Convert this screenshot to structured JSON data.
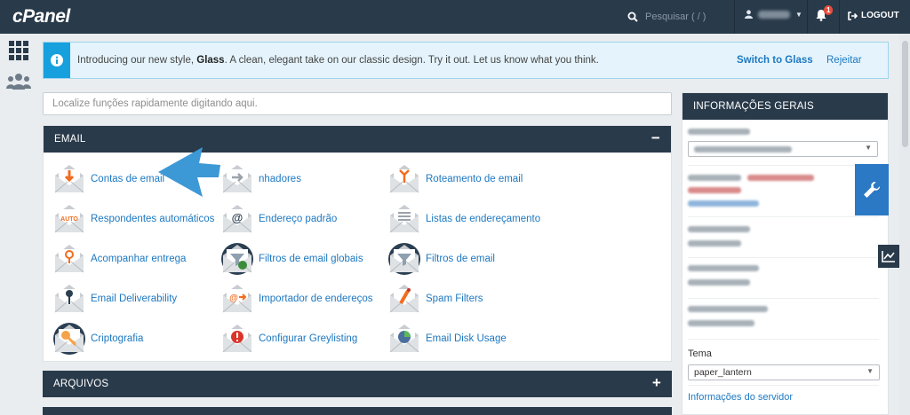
{
  "topbar": {
    "logo": "cPanel",
    "search_placeholder": "Pesquisar ( / )",
    "notification_count": "1",
    "logout_label": "LOGOUT"
  },
  "notice": {
    "text_before": "Introducing our new style, ",
    "text_bold": "Glass",
    "text_after": ". A clean, elegant take on our classic design. Try it out. Let us know what you think.",
    "switch_label": "Switch to Glass",
    "reject_label": "Rejeitar"
  },
  "quickfind": {
    "placeholder": "Localize funções rapidamente digitando aqui."
  },
  "email_section": {
    "title": "EMAIL",
    "toggle": "−",
    "items": [
      {
        "label": "Contas de email",
        "icon": "email-accounts-icon"
      },
      {
        "label": "nhadores",
        "icon": "forwarders-icon"
      },
      {
        "label": "Roteamento de email",
        "icon": "email-routing-icon"
      },
      {
        "label": "Respondentes automáticos",
        "icon": "autoresponders-icon"
      },
      {
        "label": "Endereço padrão",
        "icon": "default-address-icon"
      },
      {
        "label": "Listas de endereçamento",
        "icon": "mailing-lists-icon"
      },
      {
        "label": "Acompanhar entrega",
        "icon": "track-delivery-icon"
      },
      {
        "label": "Filtros de email globais",
        "icon": "global-filters-icon"
      },
      {
        "label": "Filtros de email",
        "icon": "email-filters-icon"
      },
      {
        "label": "Email Deliverability",
        "icon": "deliverability-icon"
      },
      {
        "label": "Importador de endereços",
        "icon": "address-importer-icon"
      },
      {
        "label": "Spam Filters",
        "icon": "spam-filters-icon"
      },
      {
        "label": "Criptografia",
        "icon": "encryption-icon"
      },
      {
        "label": "Configurar Greylisting",
        "icon": "greylisting-icon"
      },
      {
        "label": "Email Disk Usage",
        "icon": "disk-usage-icon"
      }
    ]
  },
  "files_section": {
    "title": "ARQUIVOS",
    "toggle": "+"
  },
  "sidebar": {
    "title": "INFORMAÇÕES GERAIS",
    "tema_label": "Tema",
    "tema_value": "paper_lantern",
    "server_info_link": "Informações do servidor"
  },
  "colors": {
    "topbar": "#293a4a",
    "link": "#1d78c1",
    "accent": "#16a0de",
    "arrow": "#3d98d6"
  }
}
